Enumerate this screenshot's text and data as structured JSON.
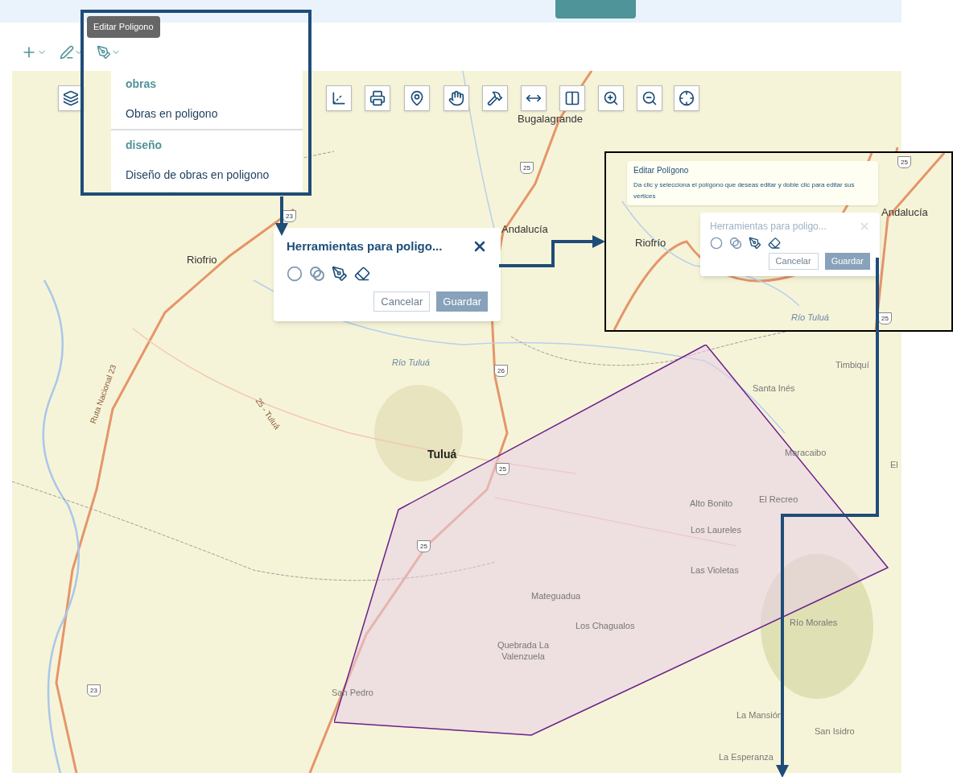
{
  "tooltip": {
    "text": "Editar Poligono"
  },
  "dropdown": {
    "sections": [
      {
        "heading": "obras",
        "items": [
          "Obras en poligono"
        ]
      },
      {
        "heading": "diseño",
        "items": [
          "Diseño de obras en poligono"
        ]
      }
    ]
  },
  "panel": {
    "title": "Herramientas para poligo...",
    "buttons": [
      "Cancelar",
      "Guardar"
    ]
  },
  "map": {
    "labels": [
      {
        "text": "Bugalagrande",
        "kind": "place"
      },
      {
        "text": "Andalucía",
        "kind": "place"
      },
      {
        "text": "Riofrio",
        "kind": "place"
      },
      {
        "text": "Río Tuluá",
        "kind": "river"
      },
      {
        "text": "Timbiquí",
        "kind": "locality"
      },
      {
        "text": "Santa Inés",
        "kind": "locality"
      },
      {
        "text": "Tuluá",
        "kind": "town"
      },
      {
        "text": "Maracaibo",
        "kind": "locality"
      },
      {
        "text": "El",
        "kind": "locality"
      },
      {
        "text": "El Recreo",
        "kind": "locality"
      },
      {
        "text": "Alto Bonito",
        "kind": "locality"
      },
      {
        "text": "Los Laureles",
        "kind": "locality"
      },
      {
        "text": "Las Violetas",
        "kind": "locality"
      },
      {
        "text": "Mateguadua",
        "kind": "locality"
      },
      {
        "text": "Los Chagualos",
        "kind": "locality"
      },
      {
        "text": "Río Morales",
        "kind": "locality"
      },
      {
        "text": "Quebrada La Valenzuela",
        "kind": "locality"
      },
      {
        "text": "San Pedro",
        "kind": "locality"
      },
      {
        "text": "La Mansión",
        "kind": "locality"
      },
      {
        "text": "San Isidro",
        "kind": "locality"
      },
      {
        "text": "La Esperanza",
        "kind": "locality"
      },
      {
        "text": "Ruta Nacional 23",
        "kind": "road"
      },
      {
        "text": "25 - Tuluá",
        "kind": "road"
      },
      {
        "text": "25",
        "kind": "shield"
      },
      {
        "text": "23",
        "kind": "shield"
      },
      {
        "text": "26",
        "kind": "shield"
      },
      {
        "text": "25",
        "kind": "shield"
      },
      {
        "text": "25",
        "kind": "shield"
      },
      {
        "text": "23",
        "kind": "shield"
      }
    ]
  },
  "inset": {
    "popover": {
      "title": "Editar Polígono",
      "text": "Da clic y selecciona el polígono que deseas editar y doble clic para editar sus vertices"
    },
    "panel": {
      "title": "Herramientas para poligo...",
      "buttons": [
        "Cancelar",
        "Guardar"
      ]
    },
    "labels": [
      {
        "text": "25",
        "kind": "shield"
      },
      {
        "text": "Andalucía",
        "kind": "place"
      },
      {
        "text": "Riofrío",
        "kind": "place"
      },
      {
        "text": "Río Tuluá",
        "kind": "river"
      },
      {
        "text": "25",
        "kind": "shield"
      }
    ]
  }
}
